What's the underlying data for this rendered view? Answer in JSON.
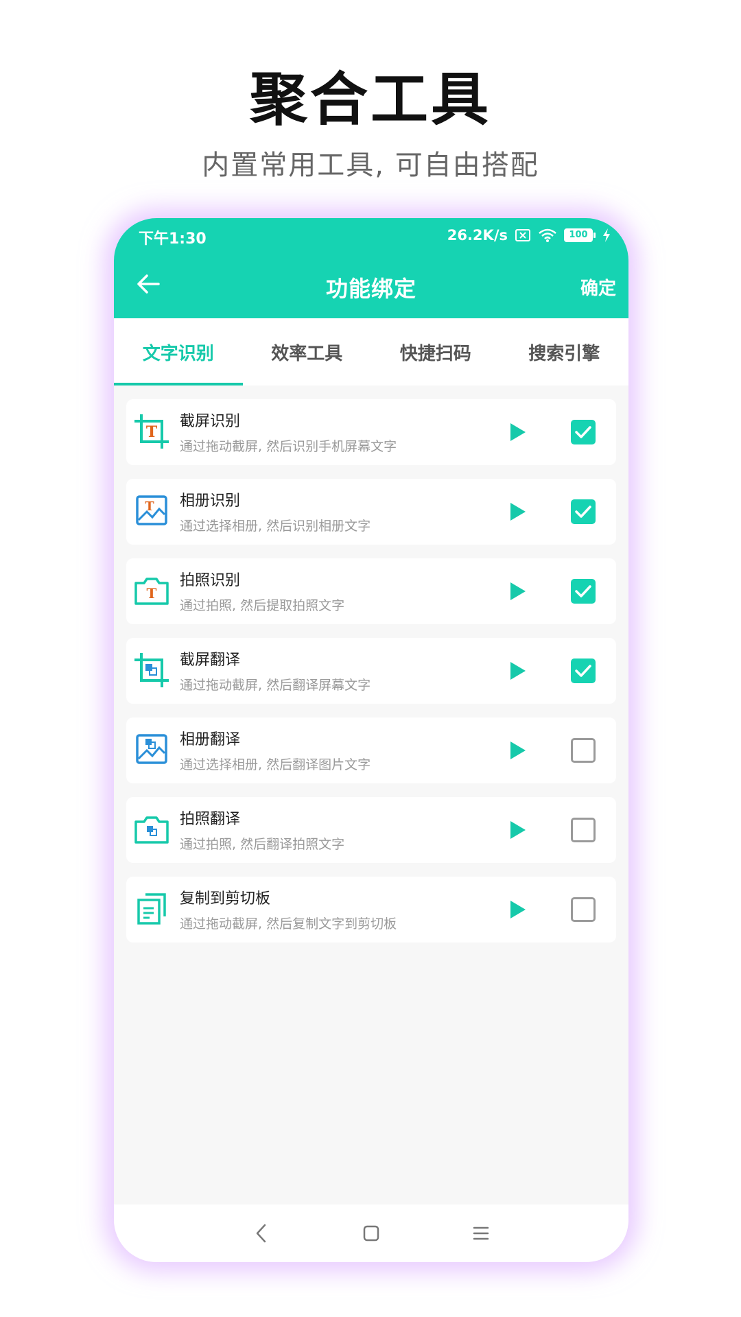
{
  "promo": {
    "title": "聚合工具",
    "subtitle": "内置常用工具, 可自由搭配"
  },
  "status": {
    "time": "下午1:30",
    "speed": "26.2K/s",
    "battery": "100"
  },
  "header": {
    "title": "功能绑定",
    "confirm": "确定"
  },
  "tabs": [
    {
      "label": "文字识别",
      "active": true
    },
    {
      "label": "效率工具",
      "active": false
    },
    {
      "label": "快捷扫码",
      "active": false
    },
    {
      "label": "搜索引擎",
      "active": false
    }
  ],
  "items": [
    {
      "title": "截屏识别",
      "desc": "通过拖动截屏, 然后识别手机屏幕文字",
      "checked": true,
      "icon": "crop-text-icon"
    },
    {
      "title": "相册识别",
      "desc": "通过选择相册, 然后识别相册文字",
      "checked": true,
      "icon": "album-text-icon"
    },
    {
      "title": "拍照识别",
      "desc": "通过拍照, 然后提取拍照文字",
      "checked": true,
      "icon": "camera-text-icon"
    },
    {
      "title": "截屏翻译",
      "desc": "通过拖动截屏, 然后翻译屏幕文字",
      "checked": true,
      "icon": "crop-translate-icon"
    },
    {
      "title": "相册翻译",
      "desc": "通过选择相册, 然后翻译图片文字",
      "checked": false,
      "icon": "album-translate-icon"
    },
    {
      "title": "拍照翻译",
      "desc": "通过拍照, 然后翻译拍照文字",
      "checked": false,
      "icon": "camera-translate-icon"
    },
    {
      "title": "复制到剪切板",
      "desc": "通过拖动截屏, 然后复制文字到剪切板",
      "checked": false,
      "icon": "copy-clipboard-icon"
    }
  ],
  "colors": {
    "accent": "#16d3b2",
    "icon_orange": "#e0651c",
    "icon_blue": "#2a8fd8"
  }
}
